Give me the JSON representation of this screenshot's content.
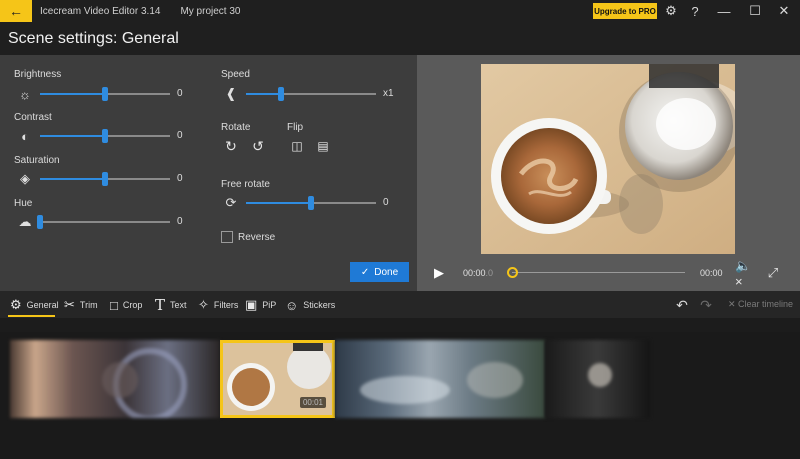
{
  "titlebar": {
    "app_title": "Icecream Video Editor 3.14",
    "project_title": "My project 30",
    "upgrade_label": "Upgrade to PRO",
    "back_icon": "arrow-left-icon",
    "settings_icon": "gear-icon",
    "help_icon": "question-icon",
    "minimize_icon": "minimize-icon",
    "maximize_icon": "maximize-icon",
    "close_icon": "close-icon"
  },
  "page": {
    "title": "Scene settings: General"
  },
  "settings": {
    "brightness": {
      "label": "Brightness",
      "value": "0",
      "level": 0.5
    },
    "contrast": {
      "label": "Contrast",
      "value": "0",
      "level": 0.5
    },
    "saturation": {
      "label": "Saturation",
      "value": "0",
      "level": 0.5
    },
    "hue": {
      "label": "Hue",
      "value": "0",
      "level": 0.0
    },
    "speed": {
      "label": "Speed",
      "value": "x1",
      "level": 0.27
    },
    "rotate": {
      "label": "Rotate"
    },
    "flip": {
      "label": "Flip"
    },
    "free_rotate": {
      "label": "Free rotate",
      "value": "0",
      "level": 0.5
    },
    "reverse": {
      "label": "Reverse",
      "checked": false
    },
    "done_label": "Done"
  },
  "preview": {
    "time_current": "00:00",
    "time_current_ms": ".0",
    "time_total": "00:00",
    "seek_level": 0.0
  },
  "toolbar": {
    "tools": [
      {
        "label": "General",
        "icon": "settings-icon",
        "active": true
      },
      {
        "label": "Trim",
        "icon": "scissors-icon"
      },
      {
        "label": "Crop",
        "icon": "crop-icon"
      },
      {
        "label": "Text",
        "icon": "text-icon"
      },
      {
        "label": "Filters",
        "icon": "filters-icon"
      },
      {
        "label": "PiP",
        "icon": "pip-icon"
      },
      {
        "label": "Stickers",
        "icon": "sticker-icon"
      }
    ],
    "clear_label": "Clear timeline"
  },
  "timeline": {
    "selected_clip_duration": "00:01",
    "accent": "#f5c518"
  },
  "colors": {
    "accent": "#f5c518",
    "done_blue": "#1f7ad6",
    "slider_blue": "#2f8ce0"
  }
}
